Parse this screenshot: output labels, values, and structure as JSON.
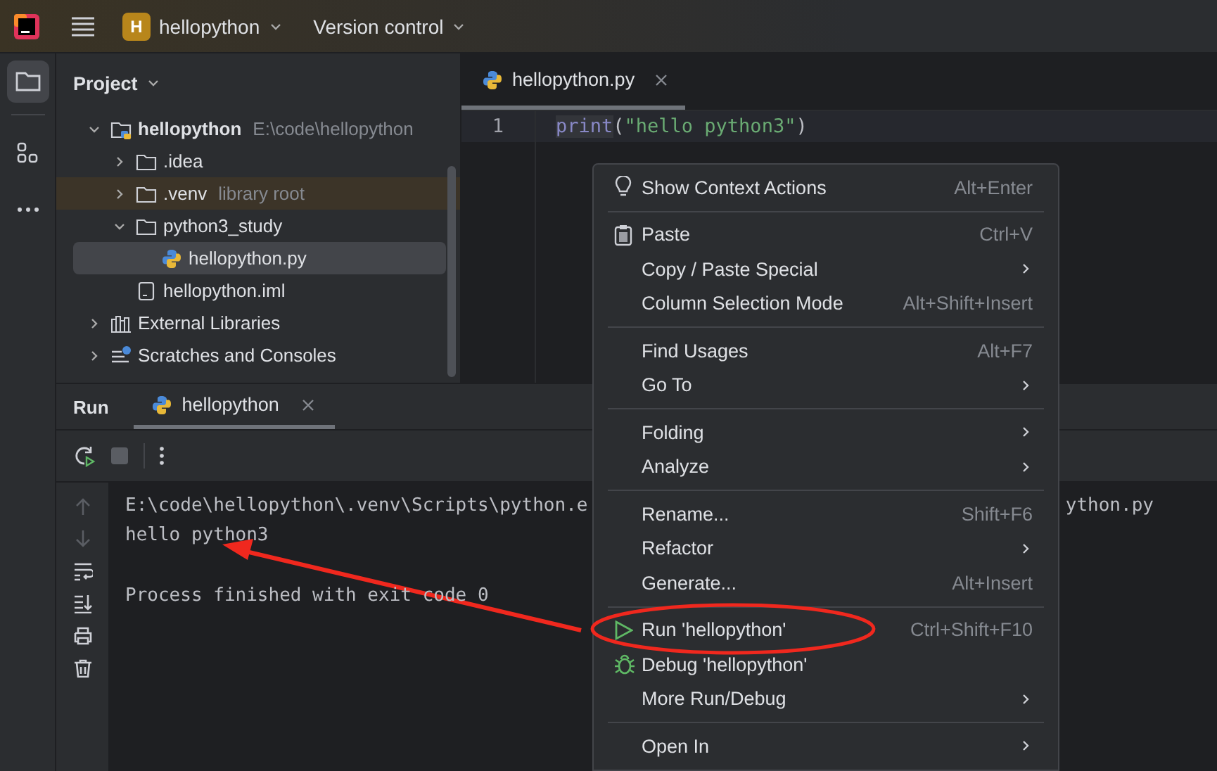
{
  "title_bar": {
    "project_badge": "H",
    "project": "hellopython",
    "vcs": "Version control"
  },
  "tool_strip": [
    {
      "kind": "folder",
      "selected": true
    },
    {
      "kind": "structure",
      "selected": false
    },
    {
      "kind": "more",
      "selected": false
    }
  ],
  "project_panel": {
    "title": "Project",
    "tree": [
      {
        "kind": "project",
        "label": "hellopython",
        "hint": "E:\\code\\hellopython",
        "expanded": true,
        "selected": false,
        "highlighted": false,
        "children": [
          {
            "kind": "folder",
            "label": ".idea",
            "expanded": false,
            "selected": false,
            "highlighted": false
          },
          {
            "kind": "folder",
            "label": ".venv",
            "hint": "library root",
            "expanded": false,
            "selected": false,
            "highlighted": true
          },
          {
            "kind": "folder",
            "label": "python3_study",
            "expanded": true,
            "selected": false,
            "highlighted": false,
            "children": [
              {
                "kind": "python",
                "label": "hellopython.py",
                "selected": true,
                "highlighted": false
              }
            ]
          },
          {
            "kind": "file",
            "label": "hellopython.iml",
            "selected": false,
            "highlighted": false
          }
        ]
      },
      {
        "kind": "libraries",
        "label": "External Libraries",
        "expanded": false,
        "selected": false,
        "highlighted": false
      },
      {
        "kind": "scratches",
        "label": "Scratches and Consoles",
        "expanded": false,
        "selected": false,
        "highlighted": false
      }
    ]
  },
  "editor": {
    "tabs": [
      {
        "label": "hellopython.py",
        "selected": true
      }
    ],
    "lines": [
      {
        "number": "1",
        "tokens": [
          {
            "kind": "function",
            "text": "print"
          },
          {
            "kind": "punct",
            "text": "("
          },
          {
            "kind": "string",
            "text": "\"hello python3\""
          },
          {
            "kind": "punct",
            "text": ")"
          }
        ]
      }
    ]
  },
  "run_panel": {
    "title": "Run",
    "tabs": [
      {
        "label": "hellopython",
        "selected": true
      }
    ],
    "console": [
      {
        "kind": "command",
        "text": "E:\\code\\hellopython\\.venv\\Scripts\\python.e",
        "tail": "ython.py"
      },
      {
        "kind": "output",
        "text": "hello python3"
      },
      {
        "kind": "status",
        "text": "Process finished with exit code 0"
      }
    ]
  },
  "context_menu": [
    {
      "kind": "context-actions",
      "label": "Show Context Actions",
      "shortcut": "Alt+Enter",
      "submenu": false
    },
    {
      "kind": "separator"
    },
    {
      "kind": "paste",
      "label": "Paste",
      "shortcut": "Ctrl+V",
      "submenu": false
    },
    {
      "kind": "item",
      "label": "Copy / Paste Special",
      "submenu": true
    },
    {
      "kind": "item",
      "label": "Column Selection Mode",
      "shortcut": "Alt+Shift+Insert",
      "submenu": false
    },
    {
      "kind": "separator"
    },
    {
      "kind": "item",
      "label": "Find Usages",
      "shortcut": "Alt+F7",
      "submenu": false
    },
    {
      "kind": "item",
      "label": "Go To",
      "submenu": true
    },
    {
      "kind": "separator"
    },
    {
      "kind": "item",
      "label": "Folding",
      "submenu": true
    },
    {
      "kind": "item",
      "label": "Analyze",
      "submenu": true
    },
    {
      "kind": "separator"
    },
    {
      "kind": "item",
      "label": "Rename...",
      "shortcut": "Shift+F6",
      "submenu": false
    },
    {
      "kind": "item",
      "label": "Refactor",
      "submenu": true
    },
    {
      "kind": "item",
      "label": "Generate...",
      "shortcut": "Alt+Insert",
      "submenu": false
    },
    {
      "kind": "separator"
    },
    {
      "kind": "run",
      "label": "Run 'hellopython'",
      "shortcut": "Ctrl+Shift+F10",
      "submenu": false
    },
    {
      "kind": "debug",
      "label": "Debug 'hellopython'",
      "submenu": false
    },
    {
      "kind": "item",
      "label": "More Run/Debug",
      "submenu": true
    },
    {
      "kind": "separator"
    },
    {
      "kind": "item",
      "label": "Open In",
      "submenu": true
    }
  ],
  "annotations": {
    "arrow": true,
    "ellipse": true
  }
}
